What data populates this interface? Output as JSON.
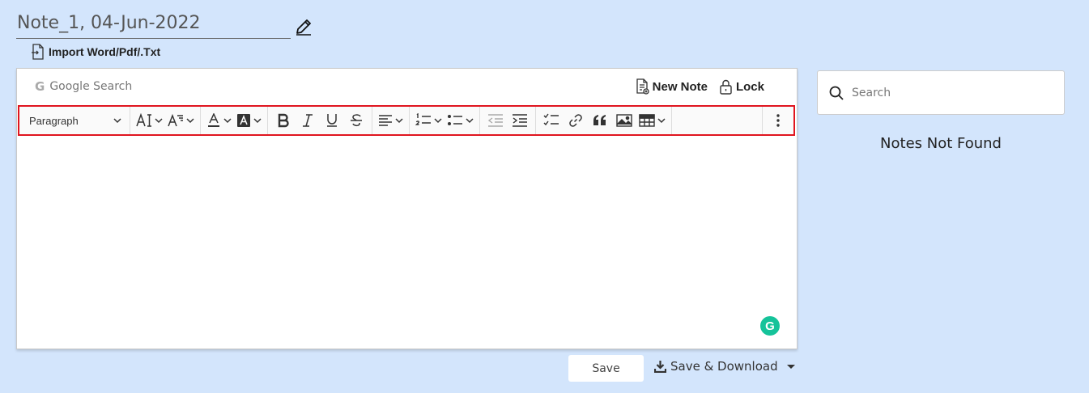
{
  "note": {
    "title": "Note_1, 04-Jun-2022",
    "import_label": "Import Word/Pdf/.Txt"
  },
  "editor": {
    "google_search_label": "Google Search",
    "new_note_label": "New Note",
    "lock_label": "Lock",
    "toolbar": {
      "paragraph_style": "Paragraph",
      "groups": [
        [
          "font-size-icon",
          "font-family-icon"
        ],
        [
          "font-color-icon",
          "background-color-icon"
        ],
        [
          "bold-icon",
          "italic-icon",
          "underline-icon",
          "strikethrough-icon"
        ],
        [
          "align-icon"
        ],
        [
          "numbered-list-icon",
          "bulleted-list-icon"
        ],
        [
          "outdent-icon",
          "indent-icon"
        ],
        [
          "todo-list-icon",
          "link-icon",
          "quote-icon",
          "image-icon",
          "table-icon"
        ],
        [
          "more-icon"
        ]
      ]
    },
    "grammarly_icon": "grammarly-icon"
  },
  "footer": {
    "save_label": "Save",
    "save_download_label": "Save & Download"
  },
  "sidebar": {
    "search_placeholder": "Search",
    "empty_message": "Notes Not Found"
  },
  "colors": {
    "background": "#d3e5fc",
    "toolbar_highlight": "#e0141e",
    "grammarly": "#15c39a"
  }
}
